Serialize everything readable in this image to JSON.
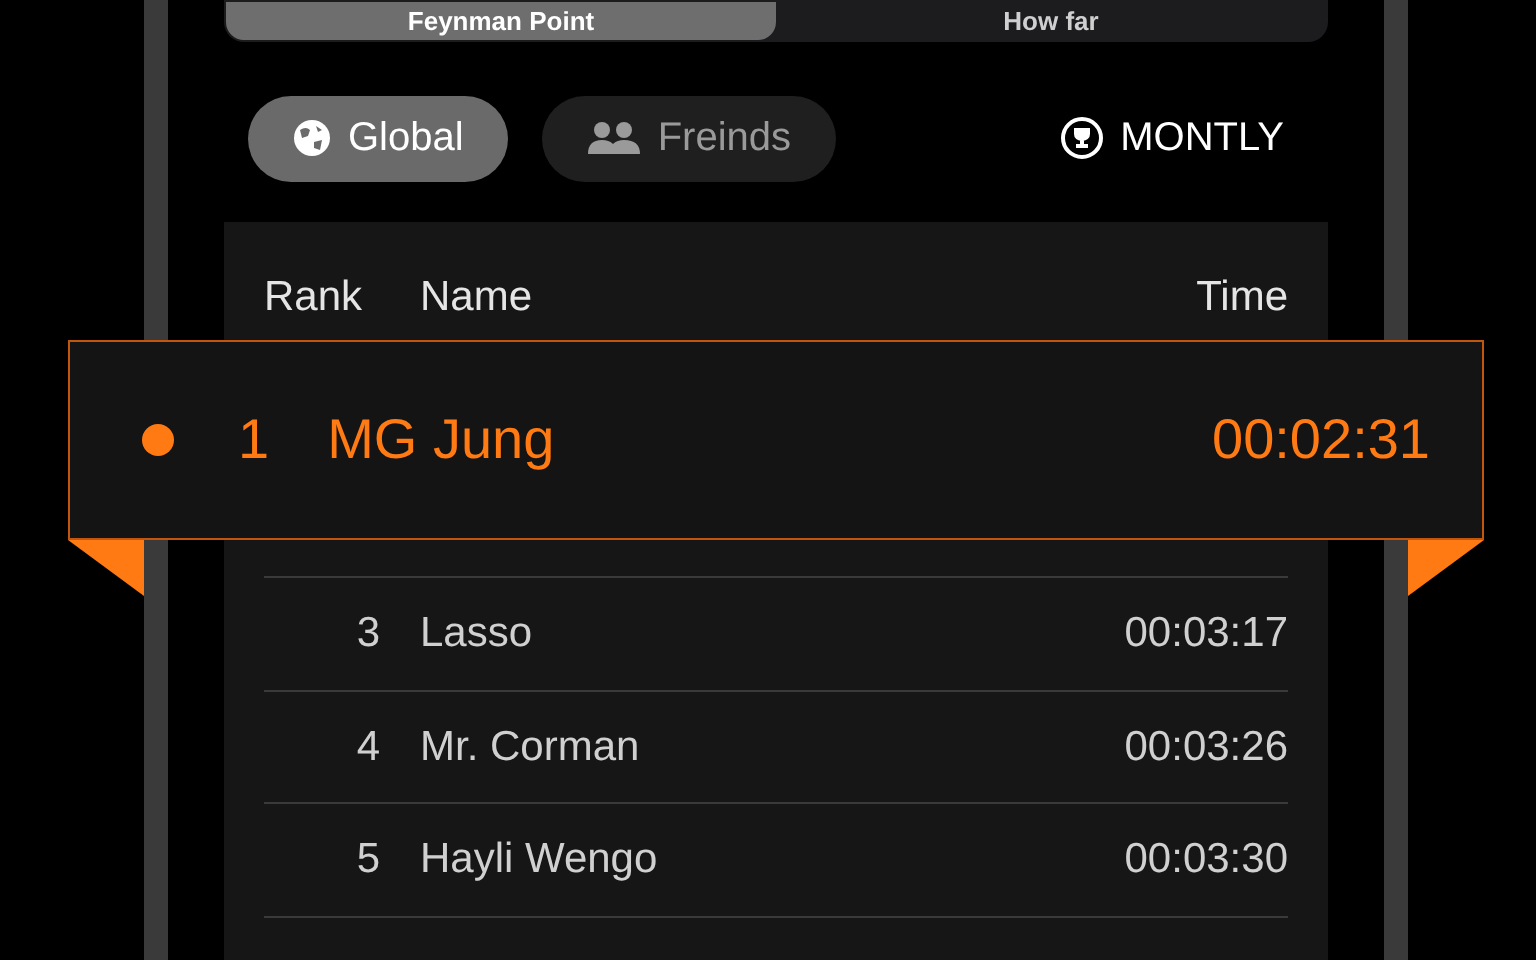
{
  "segments": [
    {
      "label": "Feynman Point",
      "selected": true
    },
    {
      "label": "How far",
      "selected": false
    }
  ],
  "filters": [
    {
      "label": "Global",
      "kind": "globe",
      "selected": true
    },
    {
      "label": "Freinds",
      "kind": "people",
      "selected": false
    }
  ],
  "period": {
    "label": "MONTLY"
  },
  "table": {
    "columns": [
      "Rank",
      "Name",
      "Time"
    ],
    "highlight": {
      "rank": "1",
      "name": "MG Jung",
      "time": "00:02:31"
    },
    "rows": [
      {
        "rank": "3",
        "name": "Lasso",
        "time": "00:03:17"
      },
      {
        "rank": "4",
        "name": "Mr. Corman",
        "time": "00:03:26"
      },
      {
        "rank": "5",
        "name": "Hayli Wengo",
        "time": "00:03:30"
      }
    ]
  }
}
